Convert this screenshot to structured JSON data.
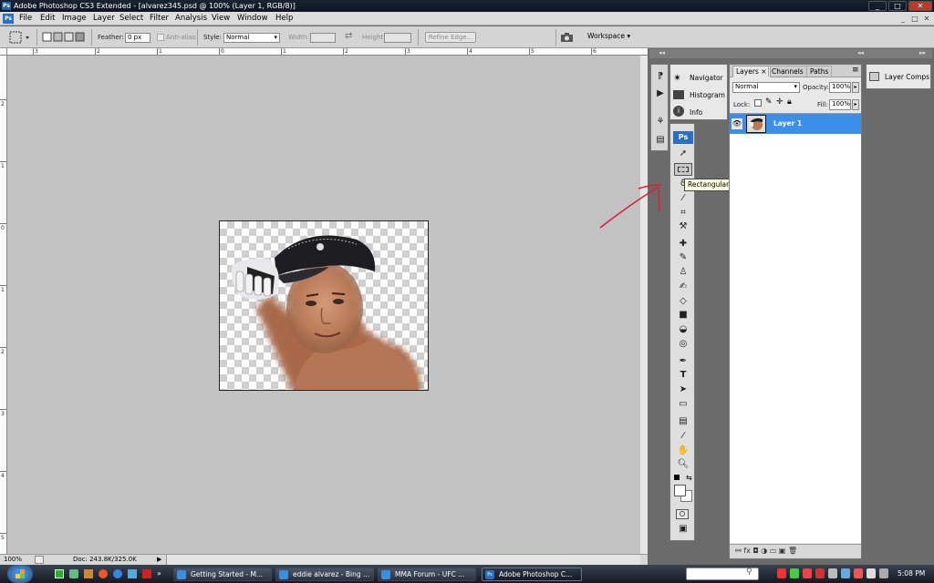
{
  "window": {
    "app_icon": "Ps",
    "title": "Adobe Photoshop CS3 Extended - [alvarez345.psd @ 100% (Layer 1, RGB/8)]",
    "minimize": "_",
    "maximize": "□",
    "close": "✕"
  },
  "menu": {
    "logo": "Ps",
    "items": [
      "File",
      "Edit",
      "Image",
      "Layer",
      "Select",
      "Filter",
      "Analysis",
      "View",
      "Window",
      "Help"
    ]
  },
  "options": {
    "feather_label": "Feather:",
    "feather_value": "0 px",
    "antialias_label": "Anti-alias",
    "style_label": "Style:",
    "style_value": "Normal",
    "width_label": "Width:",
    "height_label": "Height:",
    "refine_edge": "Refine Edge...",
    "workspace_label": "Workspace"
  },
  "rulers": {
    "h_ticks": [
      "3",
      "2",
      "1",
      "0",
      "1",
      "2",
      "3",
      "4",
      "5",
      "6"
    ],
    "v_ticks": [
      "2",
      "1",
      "0",
      "1",
      "2",
      "3",
      "4",
      "5"
    ]
  },
  "status": {
    "zoom": "100%",
    "doc": "Doc: 243.8K/325.0K"
  },
  "tooltip": "Rectangular Marquee Tool (M)",
  "tools_logo": "Ps",
  "collapsed_panels": [
    "Navigator",
    "Histogram",
    "Info"
  ],
  "layers_panel": {
    "tabs": [
      "Layers ×",
      "Channels",
      "Paths"
    ],
    "blend_mode": "Normal",
    "opacity_label": "Opacity:",
    "opacity_value": "100%",
    "lock_label": "Lock:",
    "fill_label": "Fill:",
    "fill_value": "100%",
    "layer_name": "Layer 1",
    "bottom_icons": "⚯  fx  ◘  ◑  ▭  ▣  🗑"
  },
  "layer_comps": "Layer Comps",
  "taskbar": {
    "tasks": [
      "Getting Started - M...",
      "eddie alvarez - Bing ...",
      "MMA Forum - UFC ...",
      "Adobe Photoshop C..."
    ],
    "clock": "5:08 PM"
  },
  "colors": {
    "titlebar": "#0d1520",
    "layer_selected": "#3b8fe8",
    "annotation_arrow": "#d8203a",
    "tooltip_bg": "#ffffe1"
  }
}
